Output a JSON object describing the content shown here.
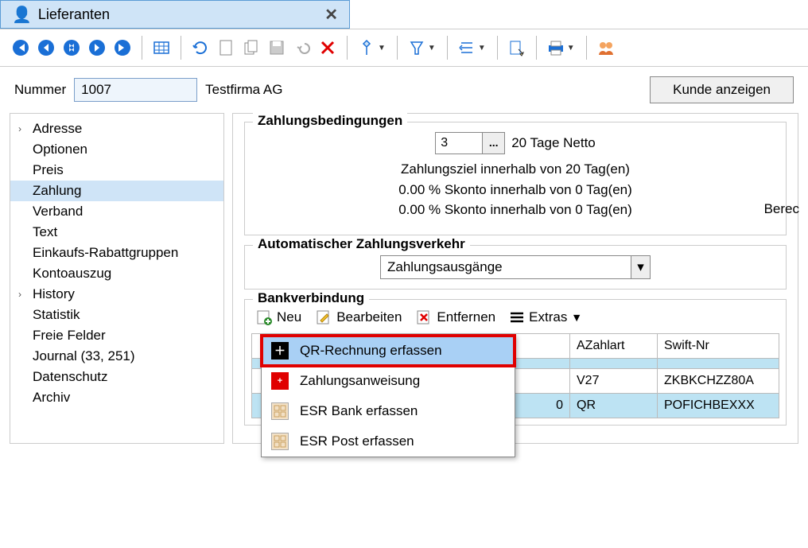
{
  "window": {
    "title": "Lieferanten"
  },
  "header": {
    "number_label": "Nummer",
    "number_value": "1007",
    "company": "Testfirma AG",
    "show_customer": "Kunde anzeigen"
  },
  "sidebar": {
    "items": [
      {
        "label": "Adresse",
        "chevron": true
      },
      {
        "label": "Optionen"
      },
      {
        "label": "Preis"
      },
      {
        "label": "Zahlung",
        "selected": true
      },
      {
        "label": "Verband"
      },
      {
        "label": "Text"
      },
      {
        "label": "Einkaufs-Rabattgruppen"
      },
      {
        "label": "Kontoauszug"
      },
      {
        "label": "History",
        "chevron": true
      },
      {
        "label": "Statistik"
      },
      {
        "label": "Freie Felder"
      },
      {
        "label": "Journal (33, 251)"
      },
      {
        "label": "Datenschutz"
      },
      {
        "label": "Archiv"
      }
    ]
  },
  "payment_terms": {
    "title": "Zahlungsbedingungen",
    "code": "3",
    "name": "20 Tage Netto",
    "line1": "Zahlungsziel innerhalb von 20 Tag(en)",
    "line2": "0.00 % Skonto innerhalb von 0 Tag(en)",
    "line3": "0.00 % Skonto innerhalb von 0 Tag(en)",
    "partial": "Berec"
  },
  "auto_payment": {
    "title": "Automatischer Zahlungsverkehr",
    "selected": "Zahlungsausgänge"
  },
  "bank": {
    "title": "Bankverbindung",
    "toolbar": {
      "new": "Neu",
      "edit": "Bearbeiten",
      "remove": "Entfernen",
      "extras": "Extras"
    },
    "columns": {
      "c1": "",
      "c2": "AZahlart",
      "c3": "Swift-Nr"
    },
    "rows": [
      {
        "c1": "",
        "c2": "",
        "c3": ""
      },
      {
        "c1": "",
        "c2": "V27",
        "c3": "ZKBKCHZZ80A"
      },
      {
        "c1": "0",
        "c2": "QR",
        "c3": "POFICHBEXXX"
      }
    ]
  },
  "new_menu": {
    "items": [
      {
        "label": "QR-Rechnung erfassen",
        "icon": "plus",
        "highlight": true,
        "framed": true
      },
      {
        "label": "Zahlungsanweisung",
        "icon": "swiss"
      },
      {
        "label": "ESR Bank erfassen",
        "icon": "grid"
      },
      {
        "label": "ESR Post erfassen",
        "icon": "grid"
      }
    ]
  }
}
